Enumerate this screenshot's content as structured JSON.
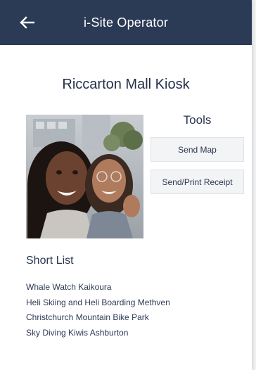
{
  "header": {
    "title": "i-Site Operator",
    "back_icon": "arrow-left-icon",
    "background": "#2b3a55"
  },
  "kiosk": {
    "name": "Riccarton Mall Kiosk",
    "photo_alt": "Two smiling women taking a selfie outdoors"
  },
  "tools": {
    "title": "Tools",
    "buttons": [
      {
        "label": "Send Map"
      },
      {
        "label": "Send/Print Receipt"
      }
    ]
  },
  "short_list": {
    "title": "Short List",
    "items": [
      "Whale Watch Kaikoura",
      "Heli Skiing and Heli Boarding Methven",
      "Christchurch Mountain Bike Park",
      "Sky Diving Kiwis Ashburton"
    ]
  }
}
